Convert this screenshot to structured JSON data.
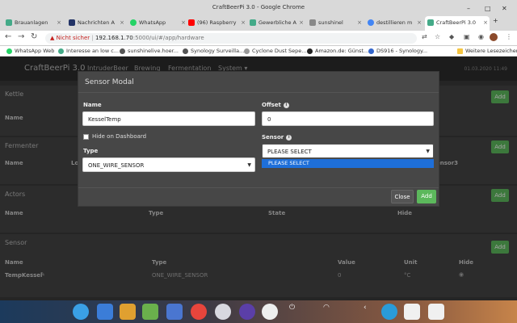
{
  "window": {
    "title": "CraftBeerPi 3.0 - Google Chrome"
  },
  "tabs": [
    {
      "label": "Brauanlagen",
      "color": "#4a8"
    },
    {
      "label": "Nachrichten A",
      "color": "#236"
    },
    {
      "label": "WhatsApp",
      "color": "#25d366"
    },
    {
      "label": "(96) Raspberry",
      "color": "#f00"
    },
    {
      "label": "Gewerbliche A",
      "color": "#4a8"
    },
    {
      "label": "sunshinel",
      "color": "#888"
    },
    {
      "label": "destillieren m",
      "color": "#4285f4"
    },
    {
      "label": "CraftBeerPi 3.0",
      "color": "#4a8"
    }
  ],
  "address": {
    "warning": "Nicht sicher",
    "host": "192.168.1.70",
    "path": ":5000/ui/#/app/hardware"
  },
  "bookmarks": [
    {
      "label": "WhatsApp Web",
      "color": "#25d366"
    },
    {
      "label": "Interesse an low c...",
      "color": "#4a8"
    },
    {
      "label": "sunshinelive.hoer...",
      "color": "#555"
    },
    {
      "label": "Synology Surveilla...",
      "color": "#555"
    },
    {
      "label": "Cyclone Dust Sepe...",
      "color": "#999"
    },
    {
      "label": "Amazon.de: Günst...",
      "color": "#222"
    },
    {
      "label": "DS916 - Synology...",
      "color": "#36c"
    },
    {
      "label": "Weitere Lesezeichen",
      "color": "#f5c542"
    }
  ],
  "app": {
    "brand": "CraftBeerPi 3.0",
    "nav": [
      "IntruderBeer",
      "Brewing",
      "Fermentation",
      "System ▾"
    ],
    "clock": "01.03.2020 11:49"
  },
  "panels": {
    "kettle": {
      "title": "Kettle",
      "name_col": "Name",
      "add": "Add"
    },
    "fermenter": {
      "title": "Fermenter",
      "name_col": "Name",
      "col_lo": "Lo",
      "col_sensor3": "ensor3",
      "add": "Add"
    },
    "actors": {
      "title": "Actors",
      "cols": [
        "Name",
        "Type",
        "State",
        "Hide"
      ],
      "add": "Add"
    },
    "sensor": {
      "title": "Sensor",
      "cols": [
        "Name",
        "Type",
        "Value",
        "Unit",
        "Hide"
      ],
      "add": "Add",
      "row": {
        "name": "TempKessel",
        "type": "ONE_WIRE_SENSOR",
        "value": "0",
        "unit": "°C"
      }
    }
  },
  "modal": {
    "title": "Sensor Modal",
    "name_label": "Name",
    "name_value": "KesselTemp",
    "offset_label": "Offset",
    "offset_value": "0",
    "hide_label": "Hide on Dashboard",
    "type_label": "Type",
    "type_value": "ONE_WIRE_SENSOR",
    "sensor_label": "Sensor",
    "sensor_value": "PLEASE SELECT",
    "dropdown_option": "PLEASE SELECT",
    "close": "Close",
    "add": "Add"
  },
  "colors": {
    "add_green": "#5cb85c",
    "close_gray": "#555"
  }
}
